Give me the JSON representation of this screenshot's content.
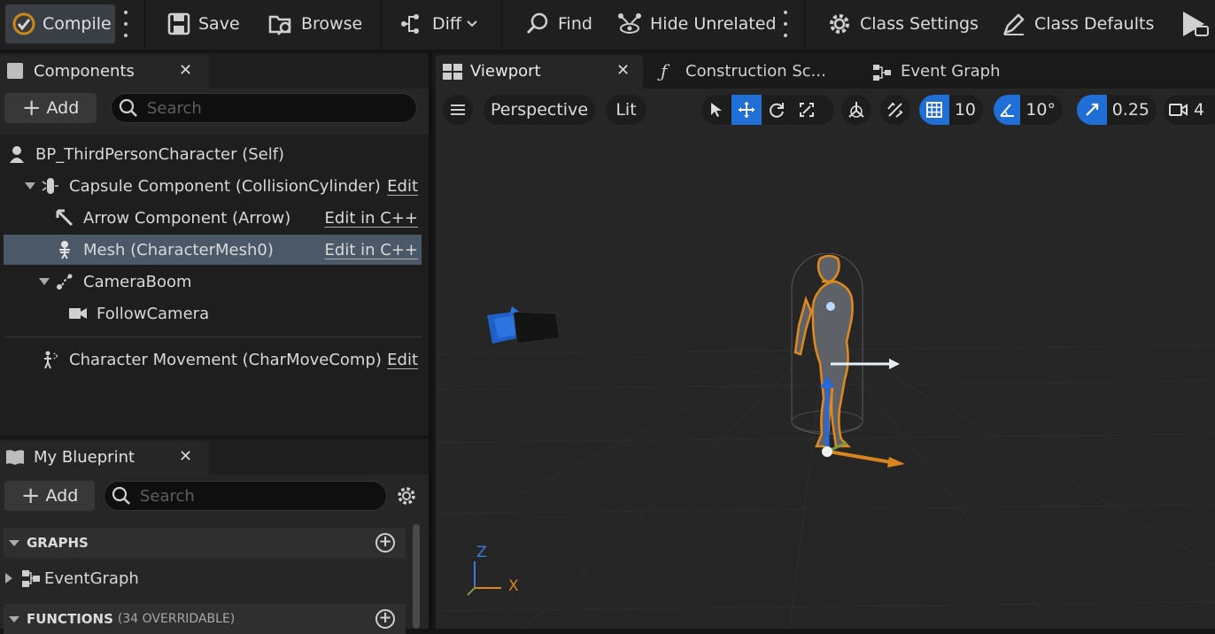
{
  "toolbar": {
    "compile": "Compile",
    "save": "Save",
    "browse": "Browse",
    "diff": "Diff",
    "find": "Find",
    "hide_unrelated": "Hide Unrelated",
    "class_settings": "Class Settings",
    "class_defaults": "Class Defaults"
  },
  "components": {
    "tab": "Components",
    "add": "Add",
    "search_placeholder": "Search",
    "items": [
      {
        "label": "BP_ThirdPersonCharacter (Self)",
        "link": ""
      },
      {
        "label": "Capsule Component (CollisionCylinder)",
        "link": "Edit"
      },
      {
        "label": "Arrow Component (Arrow)",
        "link": "Edit in C++"
      },
      {
        "label": "Mesh (CharacterMesh0)",
        "link": "Edit in C++"
      },
      {
        "label": "CameraBoom",
        "link": ""
      },
      {
        "label": "FollowCamera",
        "link": ""
      },
      {
        "label": "Character Movement (CharMoveComp)",
        "link": "Edit"
      }
    ],
    "selected_index": 3
  },
  "my_blueprint": {
    "tab": "My Blueprint",
    "add": "Add",
    "search_placeholder": "Search",
    "graphs_header": "GRAPHS",
    "event_graph": "EventGraph",
    "functions_header": "FUNCTIONS",
    "functions_sub": "(34 OVERRIDABLE)"
  },
  "editor_tabs": {
    "viewport": "Viewport",
    "construction": "Construction Sc...",
    "event_graph": "Event Graph"
  },
  "viewport": {
    "perspective": "Perspective",
    "lit": "Lit",
    "grid_snap": "10",
    "rot_snap": "10°",
    "scale_snap": "0.25",
    "camera_speed": "4",
    "axis_z": "Z",
    "axis_x": "X"
  },
  "colors": {
    "accent_blue": "#1f6fd6",
    "selection_row": "#4b5868",
    "outline_orange": "#e08a1e"
  }
}
